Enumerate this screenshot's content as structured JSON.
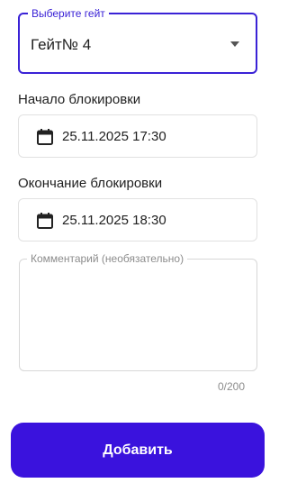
{
  "colors": {
    "accent": "#3a22d6",
    "button": "#3a12dd",
    "text": "#1f1f1f",
    "muted": "#8c8c8c",
    "border": "#e1e1e1"
  },
  "gate_select": {
    "label": "Выберите гейт",
    "value": "Гейт№ 4",
    "icon": "chevron-down-icon"
  },
  "block_start": {
    "label": "Начало блокировки",
    "value": "25.11.2025 17:30",
    "icon": "calendar-icon"
  },
  "block_end": {
    "label": "Окончание блокировки",
    "value": "25.11.2025 18:30",
    "icon": "calendar-icon"
  },
  "comment": {
    "label": "Комментарий (необязательно)",
    "value": "",
    "counter": "0/200"
  },
  "submit": {
    "label": "Добавить"
  }
}
